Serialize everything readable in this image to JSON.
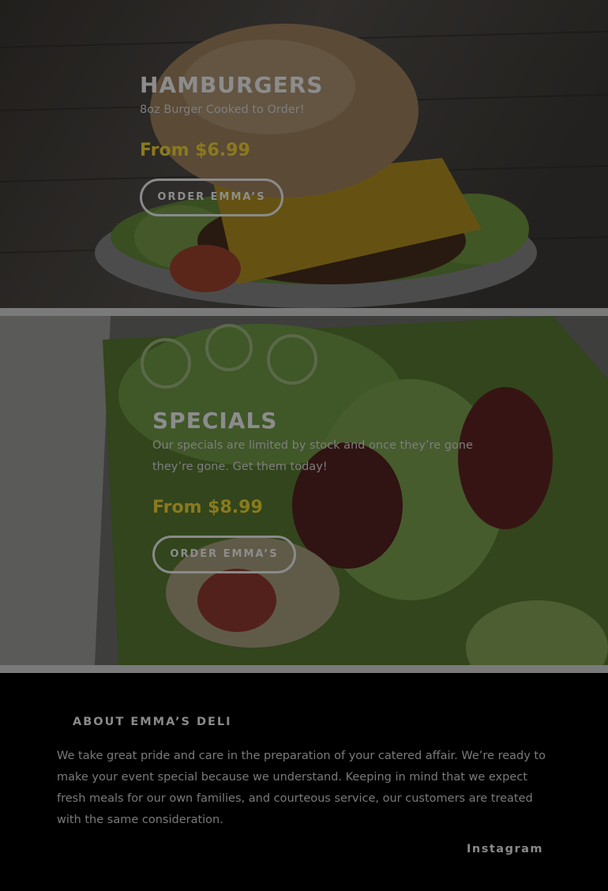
{
  "sections": [
    {
      "title": "HAMBURGERS",
      "description": "8oz Burger Cooked to Order!",
      "price": "From $6.99",
      "button_label": "ORDER EMMA’S"
    },
    {
      "title": "SPECIALS",
      "description": "Our specials are limited by stock and once they’re gone they’re gone. Get them today!",
      "price": "From $8.99",
      "button_label": "ORDER EMMA’S"
    }
  ],
  "footer": {
    "about_title": "ABOUT EMMA’S DELI",
    "about_text": "We take great pride and care in the preparation of your catered affair. We’re ready to make your event special because we understand. Keeping in mind that we expect fresh meals for our own families, and courteous service, our customers are treated with the same consideration.",
    "instagram_label": "Instagram"
  },
  "colors": {
    "price_accent": "#8a7a1e",
    "divider": "#7a7a7a",
    "footer_bg": "#000000"
  }
}
